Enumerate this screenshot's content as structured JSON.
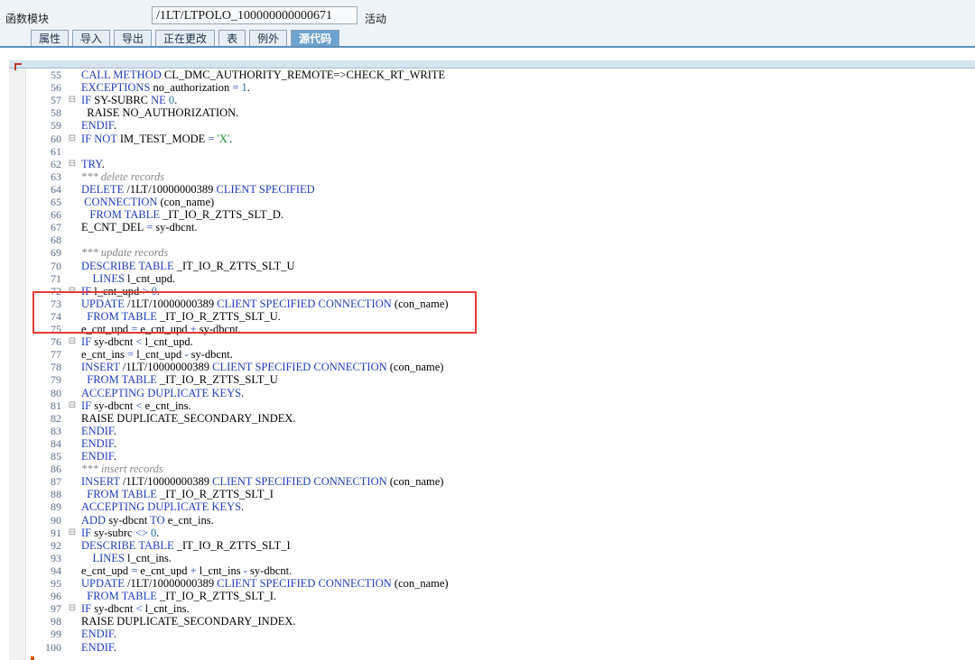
{
  "header": {
    "module_label": "函数模块",
    "module_name": "/1LT/LTPOLO_100000000000671",
    "status": "活动"
  },
  "tabs": [
    "属性",
    "导入",
    "导出",
    "正在更改",
    "表",
    "例外",
    "源代码"
  ],
  "active_tab": 6,
  "lines": [
    {
      "n": "55",
      "f": "",
      "p": [
        {
          "k": "CALL METHOD "
        },
        {
          "t": "CL_DMC_AUTHORITY_REMOTE=>CHECK_RT_WRITE"
        }
      ]
    },
    {
      "n": "56",
      "f": "",
      "p": [
        {
          "k": "EXCEPTIONS "
        },
        {
          "t": "no_authorization "
        },
        {
          "k": "= "
        },
        {
          "n": "1"
        },
        {
          "t": "."
        }
      ]
    },
    {
      "n": "57",
      "f": "⊟",
      "p": [
        {
          "k": "IF "
        },
        {
          "t": "SY-SUBRC "
        },
        {
          "k": "NE "
        },
        {
          "n": "0"
        },
        {
          "t": "."
        }
      ]
    },
    {
      "n": "58",
      "f": "",
      "p": [
        {
          "t": "  RAISE NO_AUTHORIZATION."
        }
      ]
    },
    {
      "n": "59",
      "f": "",
      "p": [
        {
          "k": "ENDIF"
        },
        {
          "t": "."
        }
      ]
    },
    {
      "n": "60",
      "f": "⊟",
      "p": [
        {
          "k": "IF NOT "
        },
        {
          "t": "IM_TEST_MODE "
        },
        {
          "k": "= "
        },
        {
          "s": "'X'"
        },
        {
          "t": "."
        }
      ]
    },
    {
      "n": "61",
      "f": "",
      "p": []
    },
    {
      "n": "62",
      "f": "⊟",
      "p": [
        {
          "k": "TRY"
        },
        {
          "t": "."
        }
      ]
    },
    {
      "n": "63",
      "f": "",
      "p": [
        {
          "c": "*** delete records"
        }
      ]
    },
    {
      "n": "64",
      "f": "",
      "p": [
        {
          "k": "DELETE "
        },
        {
          "t": "/1LT/10000000389 "
        },
        {
          "k": "CLIENT SPECIFIED"
        }
      ]
    },
    {
      "n": "65",
      "f": "",
      "p": [
        {
          "k": " CONNECTION "
        },
        {
          "t": "(con_name)"
        }
      ]
    },
    {
      "n": "66",
      "f": "",
      "p": [
        {
          "k": "   FROM TABLE "
        },
        {
          "t": "_IT_IO_R_ZTTS_SLT_D."
        }
      ]
    },
    {
      "n": "67",
      "f": "",
      "p": [
        {
          "t": "E_CNT_DEL "
        },
        {
          "k": "= "
        },
        {
          "t": "sy-dbcnt."
        }
      ]
    },
    {
      "n": "68",
      "f": "",
      "p": []
    },
    {
      "n": "69",
      "f": "",
      "p": [
        {
          "c": "*** update records"
        }
      ]
    },
    {
      "n": "70",
      "f": "",
      "p": [
        {
          "k": "DESCRIBE TABLE "
        },
        {
          "t": "_IT_IO_R_ZTTS_SLT_U"
        }
      ]
    },
    {
      "n": "71",
      "f": "",
      "p": [
        {
          "k": "    LINES "
        },
        {
          "t": "l_cnt_upd."
        }
      ]
    },
    {
      "n": "72",
      "f": "⊟",
      "p": [
        {
          "k": "IF "
        },
        {
          "t": "l_cnt_upd "
        },
        {
          "k": "> "
        },
        {
          "n": "0"
        },
        {
          "t": "."
        }
      ]
    },
    {
      "n": "73",
      "f": "",
      "p": [
        {
          "k": "UPDATE "
        },
        {
          "t": "/1LT/10000000389 "
        },
        {
          "k": "CLIENT SPECIFIED CONNECTION "
        },
        {
          "t": "(con_name)"
        }
      ]
    },
    {
      "n": "74",
      "f": "",
      "p": [
        {
          "k": "  FROM TABLE "
        },
        {
          "t": "_IT_IO_R_ZTTS_SLT_U."
        }
      ]
    },
    {
      "n": "75",
      "f": "",
      "p": [
        {
          "t": "e_cnt_upd "
        },
        {
          "k": "= "
        },
        {
          "t": "e_cnt_upd "
        },
        {
          "k": "+ "
        },
        {
          "t": "sy-dbcnt."
        }
      ]
    },
    {
      "n": "76",
      "f": "⊟",
      "p": [
        {
          "k": "IF "
        },
        {
          "t": "sy-dbcnt "
        },
        {
          "k": "< "
        },
        {
          "t": "l_cnt_upd."
        }
      ]
    },
    {
      "n": "77",
      "f": "",
      "p": [
        {
          "t": "e_cnt_ins "
        },
        {
          "k": "= "
        },
        {
          "t": "l_cnt_upd "
        },
        {
          "k": "- "
        },
        {
          "t": "sy-dbcnt."
        }
      ]
    },
    {
      "n": "78",
      "f": "",
      "p": [
        {
          "k": "INSERT "
        },
        {
          "t": "/1LT/10000000389 "
        },
        {
          "k": "CLIENT SPECIFIED CONNECTION "
        },
        {
          "t": "(con_name)"
        }
      ]
    },
    {
      "n": "79",
      "f": "",
      "p": [
        {
          "k": "  FROM TABLE "
        },
        {
          "t": "_IT_IO_R_ZTTS_SLT_U"
        }
      ]
    },
    {
      "n": "80",
      "f": "",
      "p": [
        {
          "k": "ACCEPTING DUPLICATE KEYS"
        },
        {
          "t": "."
        }
      ]
    },
    {
      "n": "81",
      "f": "⊟",
      "p": [
        {
          "k": "IF "
        },
        {
          "t": "sy-dbcnt "
        },
        {
          "k": "< "
        },
        {
          "t": "e_cnt_ins."
        }
      ]
    },
    {
      "n": "82",
      "f": "",
      "p": [
        {
          "t": "RAISE DUPLICATE_SECONDARY_INDEX."
        }
      ]
    },
    {
      "n": "83",
      "f": "",
      "p": [
        {
          "k": "ENDIF"
        },
        {
          "t": "."
        }
      ]
    },
    {
      "n": "84",
      "f": "",
      "p": [
        {
          "k": "ENDIF"
        },
        {
          "t": "."
        }
      ]
    },
    {
      "n": "85",
      "f": "",
      "p": [
        {
          "k": "ENDIF"
        },
        {
          "t": "."
        }
      ]
    },
    {
      "n": "86",
      "f": "",
      "p": [
        {
          "c": "*** insert records"
        }
      ]
    },
    {
      "n": "87",
      "f": "",
      "p": [
        {
          "k": "INSERT "
        },
        {
          "t": "/1LT/10000000389 "
        },
        {
          "k": "CLIENT SPECIFIED CONNECTION "
        },
        {
          "t": "(con_name)"
        }
      ]
    },
    {
      "n": "88",
      "f": "",
      "p": [
        {
          "k": "  FROM TABLE "
        },
        {
          "t": "_IT_IO_R_ZTTS_SLT_I"
        }
      ]
    },
    {
      "n": "89",
      "f": "",
      "p": [
        {
          "k": "ACCEPTING DUPLICATE KEYS"
        },
        {
          "t": "."
        }
      ]
    },
    {
      "n": "90",
      "f": "",
      "p": [
        {
          "k": "ADD "
        },
        {
          "t": "sy-dbcnt "
        },
        {
          "k": "TO "
        },
        {
          "t": "e_cnt_ins."
        }
      ]
    },
    {
      "n": "91",
      "f": "⊟",
      "p": [
        {
          "k": "IF "
        },
        {
          "t": "sy-subrc "
        },
        {
          "k": "<> "
        },
        {
          "n": "0"
        },
        {
          "t": "."
        }
      ]
    },
    {
      "n": "92",
      "f": "",
      "p": [
        {
          "k": "DESCRIBE TABLE "
        },
        {
          "t": "_IT_IO_R_ZTTS_SLT_I"
        }
      ]
    },
    {
      "n": "93",
      "f": "",
      "p": [
        {
          "k": "    LINES "
        },
        {
          "t": "l_cnt_ins."
        }
      ]
    },
    {
      "n": "94",
      "f": "",
      "p": [
        {
          "t": "e_cnt_upd "
        },
        {
          "k": "= "
        },
        {
          "t": "e_cnt_upd "
        },
        {
          "k": "+ "
        },
        {
          "t": "l_cnt_ins "
        },
        {
          "k": "- "
        },
        {
          "t": "sy-dbcnt."
        }
      ]
    },
    {
      "n": "95",
      "f": "",
      "p": [
        {
          "k": "UPDATE "
        },
        {
          "t": "/1LT/10000000389 "
        },
        {
          "k": "CLIENT SPECIFIED CONNECTION "
        },
        {
          "t": "(con_name)"
        }
      ]
    },
    {
      "n": "96",
      "f": "",
      "p": [
        {
          "k": "  FROM TABLE "
        },
        {
          "t": "_IT_IO_R_ZTTS_SLT_I."
        }
      ]
    },
    {
      "n": "97",
      "f": "⊟",
      "p": [
        {
          "k": "IF "
        },
        {
          "t": "sy-dbcnt "
        },
        {
          "k": "< "
        },
        {
          "t": "l_cnt_ins."
        }
      ]
    },
    {
      "n": "98",
      "f": "",
      "p": [
        {
          "t": "RAISE DUPLICATE_SECONDARY_INDEX."
        }
      ]
    },
    {
      "n": "99",
      "f": "",
      "p": [
        {
          "k": "ENDIF"
        },
        {
          "t": "."
        }
      ]
    },
    {
      "n": "100",
      "f": "",
      "p": [
        {
          "k": "ENDIF"
        },
        {
          "t": "."
        }
      ]
    }
  ]
}
